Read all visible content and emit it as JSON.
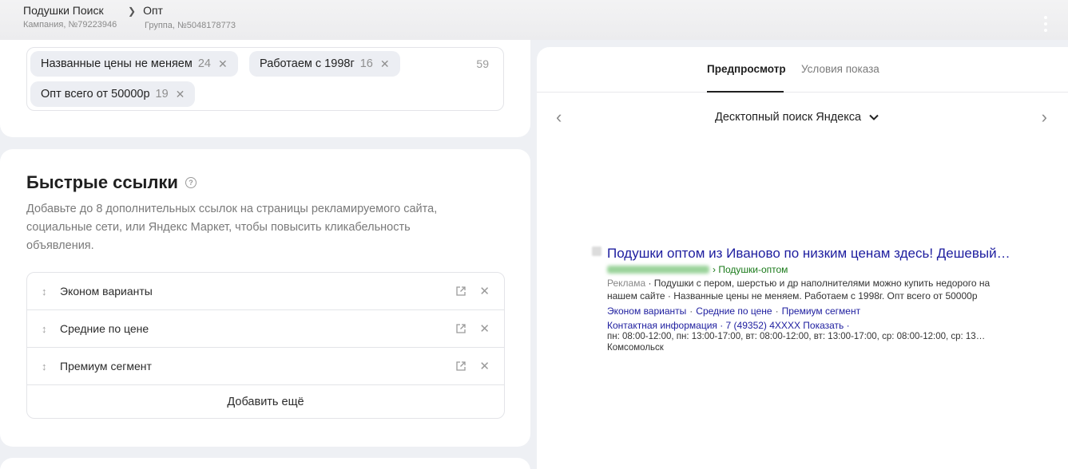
{
  "breadcrumbs": [
    {
      "title": "Подушки Поиск",
      "sub": "Кампания, №79223946"
    },
    {
      "title": "Опт",
      "sub": "Группа, №5048178773"
    }
  ],
  "callouts": {
    "tags": [
      {
        "label": "Названные цены не меняем",
        "count": "24"
      },
      {
        "label": "Работаем с 1998г",
        "count": "16"
      },
      {
        "label": "Опт всего от 50000р",
        "count": "19"
      }
    ],
    "total": "59"
  },
  "sitelinks": {
    "title": "Быстрые ссылки",
    "help_icon": "?",
    "description": "Добавьте до 8 дополнительных ссылок на страницы рекламируемого сайта, социальные сети, или Яндекс Маркет, чтобы повысить кликабельность объявления.",
    "items": [
      {
        "label": "Эконом варианты"
      },
      {
        "label": "Средние по цене"
      },
      {
        "label": "Премиум сегмент"
      }
    ],
    "add_more": "Добавить ещё"
  },
  "preview": {
    "tabs": [
      "Предпросмотр",
      "Условия показа"
    ],
    "device": "Десктопный поиск Яндекса",
    "ad": {
      "title": "Подушки оптом из Иваново по низким ценам здесь! Дешевый…",
      "path": "› Подушки-оптом",
      "label": "Реклама",
      "text": " · Подушки с пером, шерстью и др наполнителями можно купить недорого на нашем сайте · Названные цены не меняем. Работаем с 1998г. Опт всего от 50000р",
      "links": [
        "Эконом варианты",
        "Средние по цене",
        "Премиум сегмент"
      ],
      "contact": "Контактная информация  ·  7 (49352) 4XXXX Показать  ·",
      "hours": "пн: 08:00-12:00, пн: 13:00-17:00, вт: 08:00-12:00, вт: 13:00-17:00, ср: 08:00-12:00, ср: 13…",
      "city": "Комсомольск"
    }
  },
  "colors": {
    "ad_link": "#1d1d9f",
    "ad_url": "#1a7a1a",
    "background": "#eef0f4"
  }
}
